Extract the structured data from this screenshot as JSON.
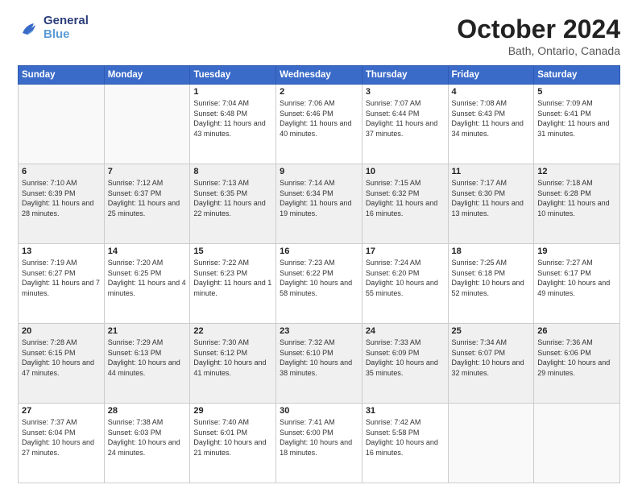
{
  "header": {
    "logo_line1": "General",
    "logo_line2": "Blue",
    "month": "October 2024",
    "location": "Bath, Ontario, Canada"
  },
  "weekdays": [
    "Sunday",
    "Monday",
    "Tuesday",
    "Wednesday",
    "Thursday",
    "Friday",
    "Saturday"
  ],
  "weeks": [
    [
      {
        "day": "",
        "detail": "",
        "empty": true
      },
      {
        "day": "",
        "detail": "",
        "empty": true
      },
      {
        "day": "1",
        "detail": "Sunrise: 7:04 AM\nSunset: 6:48 PM\nDaylight: 11 hours and 43 minutes."
      },
      {
        "day": "2",
        "detail": "Sunrise: 7:06 AM\nSunset: 6:46 PM\nDaylight: 11 hours and 40 minutes."
      },
      {
        "day": "3",
        "detail": "Sunrise: 7:07 AM\nSunset: 6:44 PM\nDaylight: 11 hours and 37 minutes."
      },
      {
        "day": "4",
        "detail": "Sunrise: 7:08 AM\nSunset: 6:43 PM\nDaylight: 11 hours and 34 minutes."
      },
      {
        "day": "5",
        "detail": "Sunrise: 7:09 AM\nSunset: 6:41 PM\nDaylight: 11 hours and 31 minutes."
      }
    ],
    [
      {
        "day": "6",
        "detail": "Sunrise: 7:10 AM\nSunset: 6:39 PM\nDaylight: 11 hours and 28 minutes."
      },
      {
        "day": "7",
        "detail": "Sunrise: 7:12 AM\nSunset: 6:37 PM\nDaylight: 11 hours and 25 minutes."
      },
      {
        "day": "8",
        "detail": "Sunrise: 7:13 AM\nSunset: 6:35 PM\nDaylight: 11 hours and 22 minutes."
      },
      {
        "day": "9",
        "detail": "Sunrise: 7:14 AM\nSunset: 6:34 PM\nDaylight: 11 hours and 19 minutes."
      },
      {
        "day": "10",
        "detail": "Sunrise: 7:15 AM\nSunset: 6:32 PM\nDaylight: 11 hours and 16 minutes."
      },
      {
        "day": "11",
        "detail": "Sunrise: 7:17 AM\nSunset: 6:30 PM\nDaylight: 11 hours and 13 minutes."
      },
      {
        "day": "12",
        "detail": "Sunrise: 7:18 AM\nSunset: 6:28 PM\nDaylight: 11 hours and 10 minutes."
      }
    ],
    [
      {
        "day": "13",
        "detail": "Sunrise: 7:19 AM\nSunset: 6:27 PM\nDaylight: 11 hours and 7 minutes."
      },
      {
        "day": "14",
        "detail": "Sunrise: 7:20 AM\nSunset: 6:25 PM\nDaylight: 11 hours and 4 minutes."
      },
      {
        "day": "15",
        "detail": "Sunrise: 7:22 AM\nSunset: 6:23 PM\nDaylight: 11 hours and 1 minute."
      },
      {
        "day": "16",
        "detail": "Sunrise: 7:23 AM\nSunset: 6:22 PM\nDaylight: 10 hours and 58 minutes."
      },
      {
        "day": "17",
        "detail": "Sunrise: 7:24 AM\nSunset: 6:20 PM\nDaylight: 10 hours and 55 minutes."
      },
      {
        "day": "18",
        "detail": "Sunrise: 7:25 AM\nSunset: 6:18 PM\nDaylight: 10 hours and 52 minutes."
      },
      {
        "day": "19",
        "detail": "Sunrise: 7:27 AM\nSunset: 6:17 PM\nDaylight: 10 hours and 49 minutes."
      }
    ],
    [
      {
        "day": "20",
        "detail": "Sunrise: 7:28 AM\nSunset: 6:15 PM\nDaylight: 10 hours and 47 minutes."
      },
      {
        "day": "21",
        "detail": "Sunrise: 7:29 AM\nSunset: 6:13 PM\nDaylight: 10 hours and 44 minutes."
      },
      {
        "day": "22",
        "detail": "Sunrise: 7:30 AM\nSunset: 6:12 PM\nDaylight: 10 hours and 41 minutes."
      },
      {
        "day": "23",
        "detail": "Sunrise: 7:32 AM\nSunset: 6:10 PM\nDaylight: 10 hours and 38 minutes."
      },
      {
        "day": "24",
        "detail": "Sunrise: 7:33 AM\nSunset: 6:09 PM\nDaylight: 10 hours and 35 minutes."
      },
      {
        "day": "25",
        "detail": "Sunrise: 7:34 AM\nSunset: 6:07 PM\nDaylight: 10 hours and 32 minutes."
      },
      {
        "day": "26",
        "detail": "Sunrise: 7:36 AM\nSunset: 6:06 PM\nDaylight: 10 hours and 29 minutes."
      }
    ],
    [
      {
        "day": "27",
        "detail": "Sunrise: 7:37 AM\nSunset: 6:04 PM\nDaylight: 10 hours and 27 minutes."
      },
      {
        "day": "28",
        "detail": "Sunrise: 7:38 AM\nSunset: 6:03 PM\nDaylight: 10 hours and 24 minutes."
      },
      {
        "day": "29",
        "detail": "Sunrise: 7:40 AM\nSunset: 6:01 PM\nDaylight: 10 hours and 21 minutes."
      },
      {
        "day": "30",
        "detail": "Sunrise: 7:41 AM\nSunset: 6:00 PM\nDaylight: 10 hours and 18 minutes."
      },
      {
        "day": "31",
        "detail": "Sunrise: 7:42 AM\nSunset: 5:58 PM\nDaylight: 10 hours and 16 minutes."
      },
      {
        "day": "",
        "detail": "",
        "empty": true
      },
      {
        "day": "",
        "detail": "",
        "empty": true
      }
    ]
  ],
  "gray_rows": [
    1,
    3
  ]
}
